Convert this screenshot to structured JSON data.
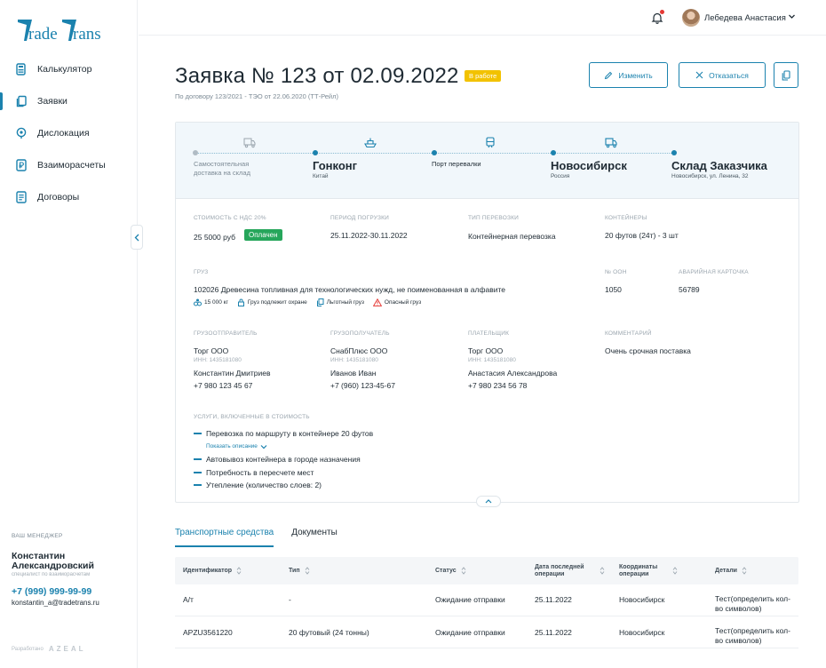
{
  "brand": {
    "logo": "TradeTrans"
  },
  "sidebar": {
    "items": [
      {
        "label": "Калькулятор",
        "icon": "calculator-icon"
      },
      {
        "label": "Заявки",
        "icon": "copy-icon"
      },
      {
        "label": "Дислокация",
        "icon": "location-pin-icon"
      },
      {
        "label": "Взаиморасчеты",
        "icon": "ruble-doc-icon"
      },
      {
        "label": "Договоры",
        "icon": "document-icon"
      }
    ],
    "active_index": 1
  },
  "manager": {
    "caption": "ВАШ МЕНЕДЖЕР",
    "name": "Константин Александровский",
    "role": "специалист по взаиморасчетам",
    "phone": "+7 (999) 999-99-99",
    "email": "konstantin_a@tradetrans.ru"
  },
  "developer": {
    "label": "Разработано",
    "logo": "AZEAL"
  },
  "header": {
    "user_name": "Лебедева Анастасия",
    "notification_dot": true
  },
  "order": {
    "title": "Заявка № 123 от 02.09.2022",
    "status": "В работе",
    "subtitle": "По договору 123/2021 - ТЭО от 22.06.2020 (ТТ-Рейл)"
  },
  "actions": {
    "edit": "Изменить",
    "cancel": "Отказаться"
  },
  "route": {
    "stops": [
      {
        "name": "Самостоятельная доставка на склад",
        "sub": "",
        "style": "grey",
        "icon": "truck-icon"
      },
      {
        "name": "Гонконг",
        "sub": "Китай",
        "style": "bold",
        "icon": "ship-icon"
      },
      {
        "name": "Порт перевалки",
        "sub": "",
        "style": "normal",
        "icon": "train-icon"
      },
      {
        "name": "Новосибирск",
        "sub": "Россия",
        "style": "bold",
        "icon": "truck-icon"
      },
      {
        "name": "Склад Заказчика",
        "sub": "Новосибирск, ул. Ленина, 32",
        "style": "bold",
        "icon": ""
      }
    ]
  },
  "details": {
    "cost": {
      "label": "СТОИМОСТЬ С НДС 20%",
      "value": "25 5000 руб",
      "badge": "Оплачен"
    },
    "loading_period": {
      "label": "ПЕРИОД ПОГРУЗКИ",
      "value": "25.11.2022-30.11.2022"
    },
    "transport_type": {
      "label": "ТИП ПЕРЕВОЗКИ",
      "value": "Контейнерная перевозка"
    },
    "containers": {
      "label": "КОНТЕЙНЕРЫ",
      "value": "20 футов (24т) - 3 шт"
    },
    "cargo": {
      "label": "ГРУЗ",
      "value": "102026 Древесина топливная для технологических нужд, не поименованная в алфавите"
    },
    "un_number": {
      "label": "№ ООН",
      "value": "1050"
    },
    "emergency_card": {
      "label": "АВАРИЙНАЯ КАРТОЧКА",
      "value": "56789"
    },
    "tags": [
      {
        "label": "15 000 кг",
        "icon": "weight-icon"
      },
      {
        "label": "Груз подлежит охране",
        "icon": "lock-icon"
      },
      {
        "label": "Льготный груз",
        "icon": "copy-icon"
      },
      {
        "label": "Опасный груз",
        "icon": "warning-icon"
      }
    ],
    "shipper": {
      "label": "ГРУЗООТПРАВИТЕЛЬ",
      "company": "Торг ООО",
      "inn": "ИНН: 1435181080",
      "contact": "Константин Дмитриев",
      "phone": "+7 980 123 45 67"
    },
    "consignee": {
      "label": "ГРУЗОПОЛУЧАТЕЛЬ",
      "company": "СнабПлюс ООО",
      "inn": "ИНН: 1435181080",
      "contact": "Иванов Иван",
      "phone": "+7 (960) 123-45-67"
    },
    "payer": {
      "label": "ПЛАТЕЛЬЩИК",
      "company": "Торг ООО",
      "inn": "ИНН: 1435181080",
      "contact": "Анастасия Александрова",
      "phone": "+7 980 234 56 78"
    },
    "comment": {
      "label": "КОММЕНТАРИЙ",
      "value": "Очень срочная поставка"
    },
    "services": {
      "label": "УСЛУГИ, ВКЛЮЧЕННЫЕ В СТОИМОСТЬ",
      "items": [
        "Перевозка по маршруту в контейнере 20 футов",
        "Автовывоз контейнера в городе назначения",
        "Потребность в пересчете мест",
        "Утепление (количество слоев: 2)"
      ],
      "show_description": "Показать описание"
    }
  },
  "tabs": [
    {
      "label": "Транспортные средства",
      "active": true
    },
    {
      "label": "Документы",
      "active": false
    }
  ],
  "table": {
    "columns": [
      "Идентификатор",
      "Тип",
      "Статус",
      "Дата последней операции",
      "Координаты операции",
      "Детали"
    ],
    "rows": [
      [
        "А/т",
        "-",
        "Ожидание отправки",
        "25.11.2022",
        "Новосибирск",
        "Тест(определить кол-во символов)"
      ],
      [
        "APZU3561220",
        "20 футовый (24 тонны)",
        "Ожидание отправки",
        "25.11.2022",
        "Новосибирск",
        "Тест(определить кол-во символов)"
      ]
    ]
  },
  "colors": {
    "accent": "#1b82ae",
    "status_in_work": "#f2c200",
    "paid": "#26a65b",
    "danger": "#e53935"
  }
}
